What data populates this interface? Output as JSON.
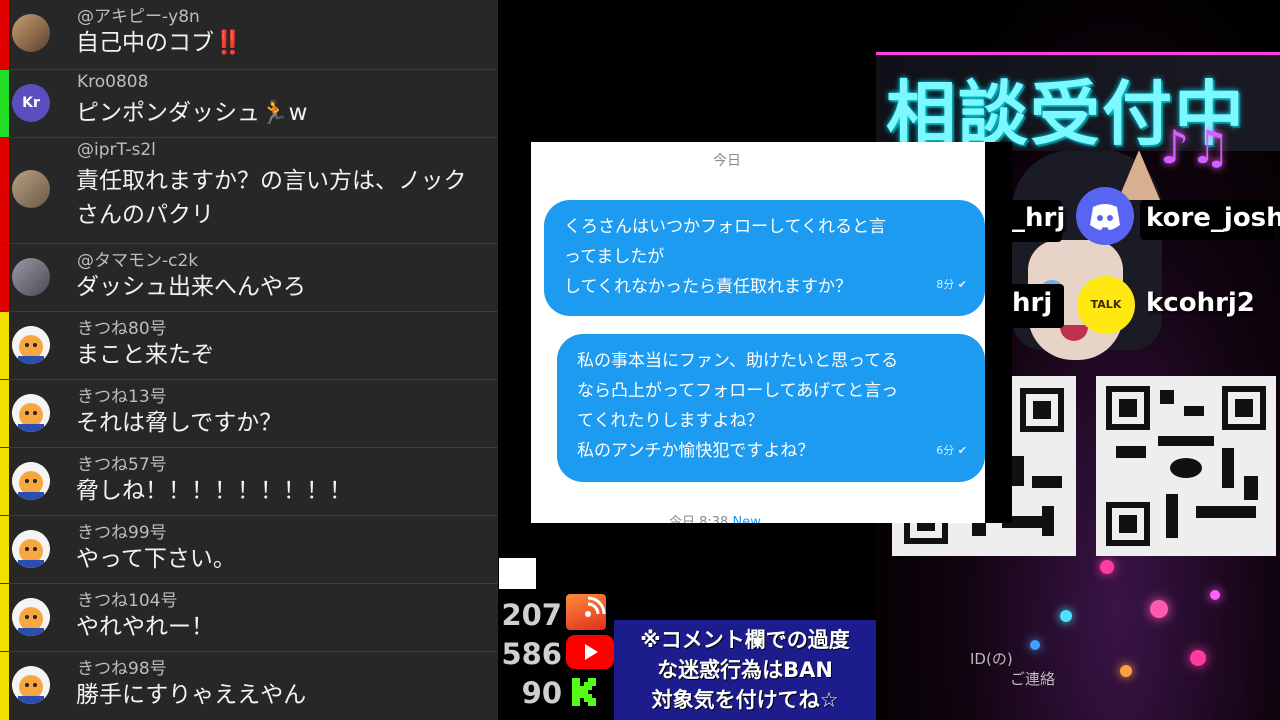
{
  "comments": [
    {
      "user": "@アキピー-y8n",
      "message": "自己中のコブ‼️",
      "bar_color": "#e00000",
      "avatar": "photo-avatar"
    },
    {
      "user": "Kro0808",
      "message": "ピンポンダッシュ🏃w",
      "bar_color": "#22dd22",
      "avatar": "initials-avatar",
      "initials": "Kr"
    },
    {
      "user": "@iprT-s2l",
      "message": "責任取れますか？の言い方は、ノックさんのパクリ",
      "bar_color": "#e00000",
      "avatar": "photo-avatar"
    },
    {
      "user": "@タマモン-c2k",
      "message": "ダッシュ出来へんやろ",
      "bar_color": "#e00000",
      "avatar": "photo-avatar"
    },
    {
      "user": "きつね80号",
      "message": "まこと来たぞ",
      "bar_color": "#f0e000",
      "avatar": "fox-avatar"
    },
    {
      "user": "きつね13号",
      "message": "それは脅しですか？",
      "bar_color": "#f0e000",
      "avatar": "fox-avatar"
    },
    {
      "user": "きつね57号",
      "message": "脅しね！！！！！！！！！",
      "bar_color": "#f0e000",
      "avatar": "fox-avatar"
    },
    {
      "user": "きつね99号",
      "message": "やって下さい。",
      "bar_color": "#f0e000",
      "avatar": "fox-avatar"
    },
    {
      "user": "きつね104号",
      "message": "やれやれー！",
      "bar_color": "#f0e000",
      "avatar": "fox-avatar"
    },
    {
      "user": "きつね98号",
      "message": "勝手にすりゃええやん",
      "bar_color": "#f0e000",
      "avatar": "fox-avatar"
    }
  ],
  "counters": [
    {
      "value": "207",
      "platform": "broadcast-icon"
    },
    {
      "value": "586",
      "platform": "youtube-icon"
    },
    {
      "value": "90",
      "platform": "kick-icon"
    }
  ],
  "dm": {
    "date": "今日",
    "bubble1": {
      "lines": [
        "くろさんはいつかフォローしてくれると言",
        "ってましたが",
        "してくれなかったら責任取れますか？"
      ],
      "time": "8分 ✔"
    },
    "bubble2": {
      "lines": [
        "私の事本当にファン、助けたいと思ってる",
        "なら凸上がってフォローしてあげてと言っ",
        "てくれたりしますよね？",
        "私のアンチか愉快犯ですよね？"
      ],
      "time": "6分 ✔"
    },
    "footer_time": "今日 8:38",
    "footer_new": "New"
  },
  "overlay": {
    "title": "相談受付中",
    "discord_partial": "_hrj",
    "discord_handle": "kore_joshi",
    "talk_partial": "hrj",
    "talk_label": "TALK",
    "talk_handle": "kcohrj2",
    "music_icon": "♪♫",
    "contact1": "ID(の)",
    "contact2": "ご連絡"
  },
  "notice": {
    "line1": "※コメント欄での過度",
    "line2": "な迷惑行為はBAN",
    "line3": "対象気を付けてね☆"
  }
}
